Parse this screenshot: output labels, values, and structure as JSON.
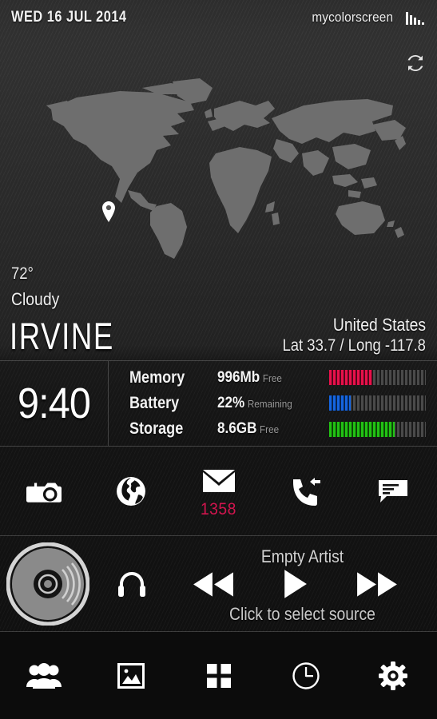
{
  "statusbar": {
    "date": "WED 16 JUL 2014",
    "brand": "mycolorscreen",
    "signal_icon": "signal-bars-icon"
  },
  "sync": {
    "icon": "sync-refresh-icon"
  },
  "map": {
    "marker_icon": "map-pin-icon",
    "map_color": "#6e6e6e",
    "marker_color": "#ffffff"
  },
  "weather": {
    "temperature": "72°",
    "condition": "Cloudy",
    "city": "IRVINE",
    "country": "United States",
    "coords": "Lat 33.7 / Long -117.8"
  },
  "clock": {
    "time": "9:40"
  },
  "stats": {
    "rows": [
      {
        "label": "Memory",
        "value": "996Mb",
        "suffix": "Free",
        "percent": 45,
        "color": "#e8114b"
      },
      {
        "label": "Battery",
        "value": "22%",
        "suffix": "Remaining",
        "percent": 22,
        "color": "#1565e0"
      },
      {
        "label": "Storage",
        "value": "8.6GB",
        "suffix": "Free",
        "percent": 68,
        "color": "#22c214"
      }
    ],
    "track_color": "#4a4a4a"
  },
  "apps": [
    {
      "name": "camera",
      "icon": "camera-icon",
      "badge": ""
    },
    {
      "name": "browser",
      "icon": "globe-icon",
      "badge": ""
    },
    {
      "name": "mail",
      "icon": "envelope-icon",
      "badge": "1358"
    },
    {
      "name": "phone",
      "icon": "phone-incoming-icon",
      "badge": ""
    },
    {
      "name": "messaging",
      "icon": "chat-bubble-icon",
      "badge": ""
    }
  ],
  "badge_color": "#d4154f",
  "music": {
    "artist": "Empty Artist",
    "source_hint": "Click to select source",
    "album_icon": "vinyl-disc-icon",
    "headphones_icon": "headphones-icon",
    "prev_icon": "rewind-icon",
    "play_icon": "play-icon",
    "next_icon": "fast-forward-icon"
  },
  "dock": [
    {
      "name": "contacts",
      "icon": "people-icon"
    },
    {
      "name": "gallery",
      "icon": "photo-frame-icon"
    },
    {
      "name": "appdrawer",
      "icon": "grid-squares-icon"
    },
    {
      "name": "clock",
      "icon": "clock-icon"
    },
    {
      "name": "settings",
      "icon": "gear-icon"
    }
  ]
}
